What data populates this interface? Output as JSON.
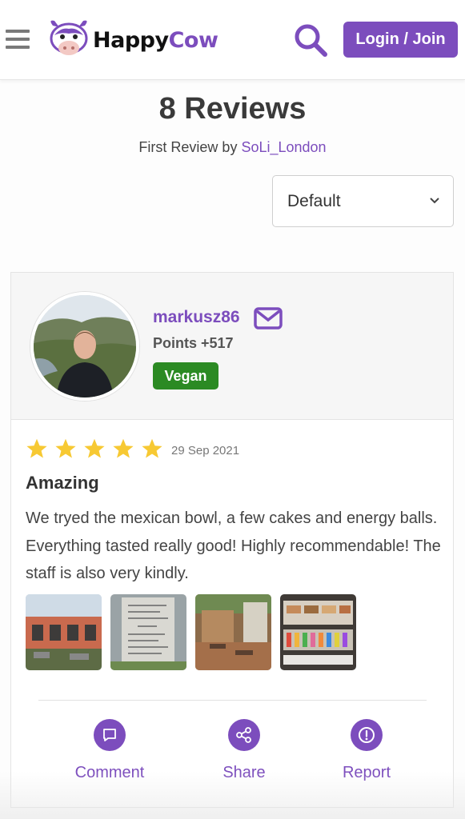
{
  "header": {
    "logo": {
      "happy": "Happy",
      "cow": "Cow"
    },
    "login_label": "Login / Join"
  },
  "summary": {
    "title": "8 Reviews",
    "first_review_prefix": "First Review by",
    "first_review_author": "SoLi_London",
    "sort_value": "Default"
  },
  "review": {
    "user": {
      "name": "markusz86",
      "points": "Points +517",
      "badge": "Vegan"
    },
    "rating": 5,
    "date": "29 Sep 2021",
    "title": "Amazing",
    "text": "We tryed the mexican bowl, a few cakes and energy balls. Everything tasted really good! Highly recommendable! The staff is also very kindly.",
    "actions": {
      "comment": "Comment",
      "share": "Share",
      "report": "Report"
    }
  },
  "colors": {
    "brand": "#7c4dbd",
    "vegan": "#2b8a23",
    "star": "#f7c933"
  },
  "icons": [
    "menu-icon",
    "search-icon",
    "mail-icon",
    "star-icon",
    "chevron-down-icon",
    "comment-icon",
    "share-icon",
    "report-icon"
  ]
}
